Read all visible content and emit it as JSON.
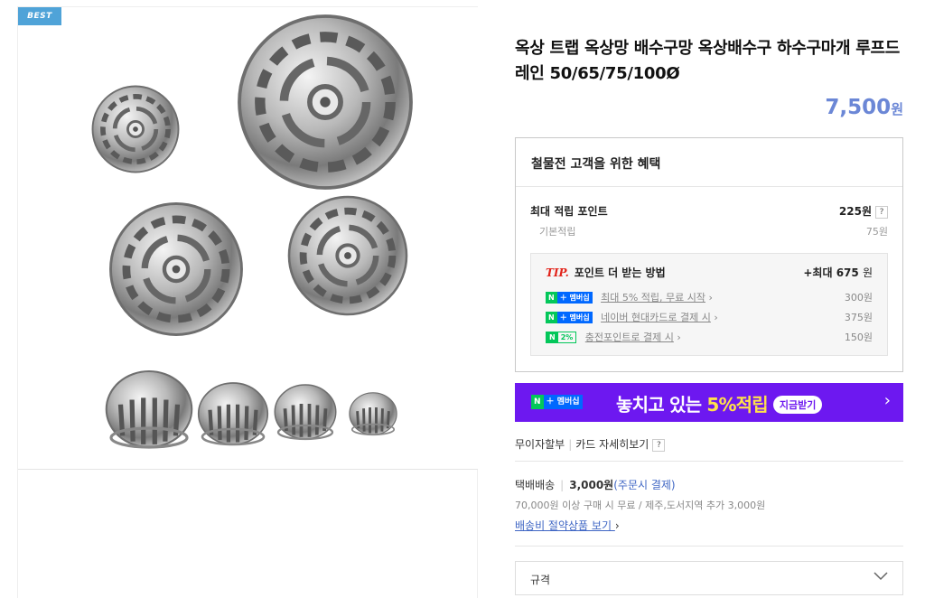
{
  "badge": "BEST",
  "product": {
    "title": "옥상 트랩 옥상망 배수구망 옥상배수구 하수구마개 루프드레인 50/65/75/100Ø",
    "price": "7,500",
    "price_unit": "원"
  },
  "benefit": {
    "header": "철물전 고객을 위한 혜택",
    "max_points_label": "최대 적립 포인트",
    "max_points_value": "225원",
    "q": "?",
    "basic_label": "기본적립",
    "basic_value": "75원",
    "tip": {
      "tip_word": "TIP.",
      "title": "포인트 더 받는 방법",
      "max_label": "+최대",
      "max_value": "675",
      "max_unit": "원",
      "rows": [
        {
          "badge_n": "N",
          "badge_p": "＋ 멤버십",
          "label": "최대 5% 적립, 무료 시작",
          "chev": "›",
          "amount": "300원"
        },
        {
          "badge_n": "N",
          "badge_p": "＋ 멤버십",
          "label": "네이버 현대카드로 결제 시",
          "chev": "›",
          "amount": "375원"
        },
        {
          "badge_n": "N",
          "badge_p": "2%",
          "label": "충전포인트로 결제 시",
          "chev": "›",
          "amount": "150원"
        }
      ]
    }
  },
  "banner": {
    "badge_n": "N",
    "badge_p": "＋ 멤버십",
    "text_pre": "놓치고 있는 ",
    "text_em": "5%적립",
    "now": "지금받기",
    "arrow": "›"
  },
  "links": {
    "interest_free": "무이자할부",
    "card_detail": "카드 자세히보기",
    "q": "?"
  },
  "shipping": {
    "label": "택배배송",
    "fee": "3,000원",
    "fee_note": "(주문시 결제)",
    "line2": "70,000원 이상 구매 시 무료 / 제주,도서지역 추가 3,000원",
    "link": "배송비 절약상품 보기",
    "chev": "›"
  },
  "option": {
    "label": "규격"
  },
  "colors": {
    "price": "#6b87d6",
    "banner": "#6d18f0",
    "naver_green": "#03c75a"
  }
}
